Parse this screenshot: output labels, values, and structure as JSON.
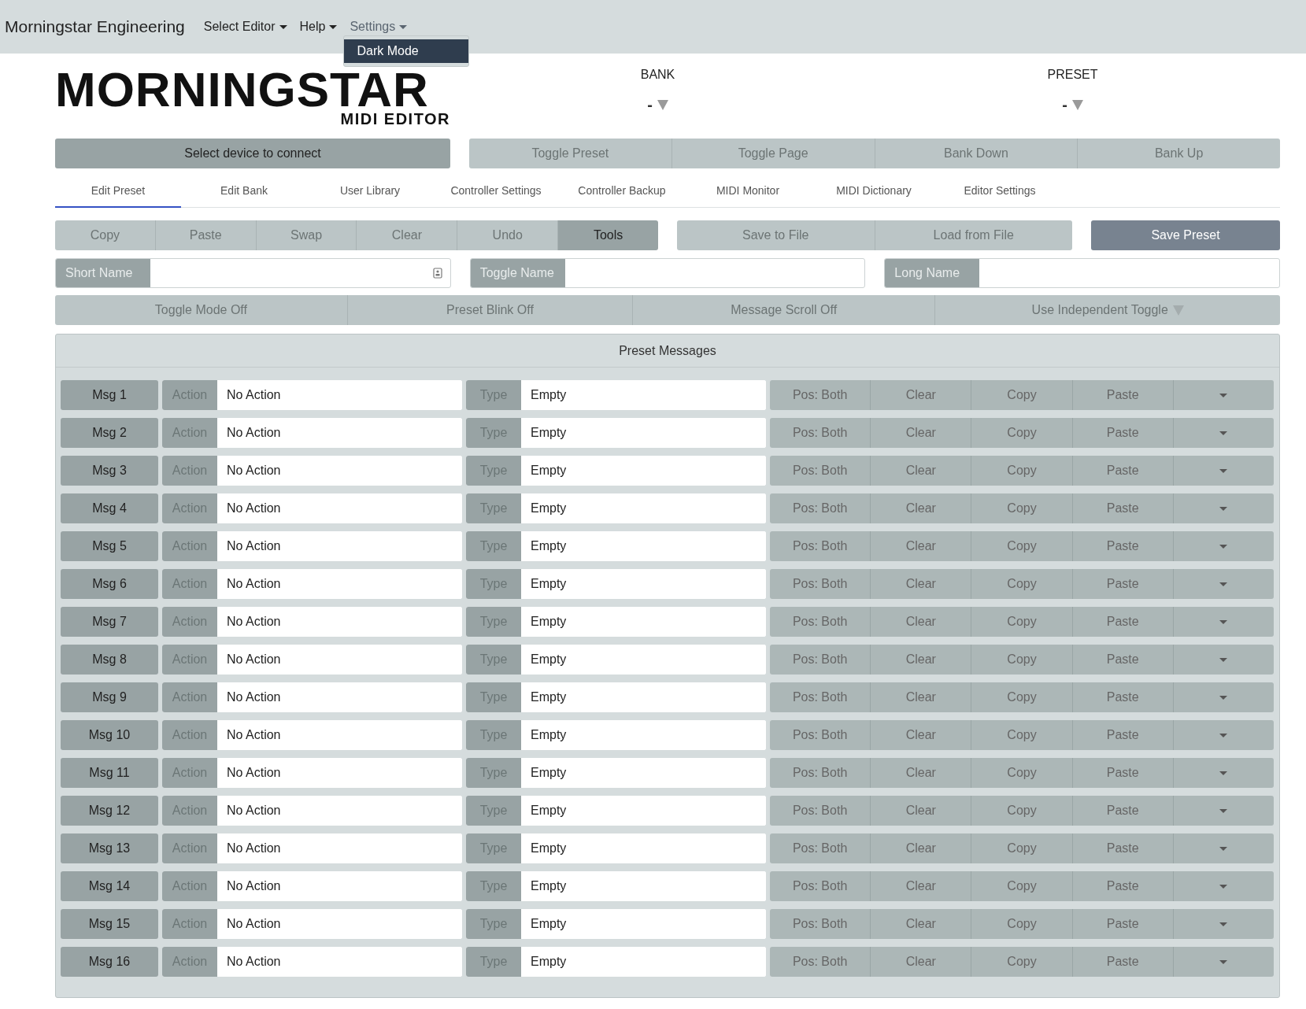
{
  "navbar": {
    "brand": "Morningstar Engineering",
    "menus": [
      {
        "label": "Select Editor",
        "open": false
      },
      {
        "label": "Help",
        "open": false
      },
      {
        "label": "Settings",
        "open": true
      }
    ],
    "dropdown": {
      "items": [
        {
          "label": "Dark Mode",
          "selected": true
        }
      ]
    }
  },
  "header": {
    "logo": {
      "title": "MORNINGSTAR",
      "subtitle": "MIDI EDITOR"
    },
    "selectors": [
      {
        "label": "BANK",
        "value": "-"
      },
      {
        "label": "PRESET",
        "value": "-"
      }
    ]
  },
  "connect_button": "Select device to connect",
  "transport_buttons": [
    "Toggle Preset",
    "Toggle Page",
    "Bank Down",
    "Bank Up"
  ],
  "tabs": [
    {
      "label": "Edit Preset",
      "selected": true
    },
    {
      "label": "Edit Bank",
      "selected": false
    },
    {
      "label": "User Library",
      "selected": false
    },
    {
      "label": "Controller Settings",
      "selected": false
    },
    {
      "label": "Controller Backup",
      "selected": false
    },
    {
      "label": "MIDI Monitor",
      "selected": false
    },
    {
      "label": "MIDI Dictionary",
      "selected": false
    },
    {
      "label": "Editor Settings",
      "selected": false
    }
  ],
  "edit_tools": [
    {
      "label": "Copy",
      "selected": false
    },
    {
      "label": "Paste",
      "selected": false
    },
    {
      "label": "Swap",
      "selected": false
    },
    {
      "label": "Clear",
      "selected": false
    },
    {
      "label": "Undo",
      "selected": false
    },
    {
      "label": "Tools",
      "selected": true
    }
  ],
  "file_buttons": [
    "Save to File",
    "Load from File"
  ],
  "save_button": "Save Preset",
  "name_fields": [
    {
      "label": "Short Name",
      "icon": true
    },
    {
      "label": "Toggle Name",
      "icon": false
    },
    {
      "label": "Long Name",
      "icon": false
    }
  ],
  "toggles": [
    {
      "label": "Toggle Mode Off",
      "kind": "button"
    },
    {
      "label": "Preset Blink Off",
      "kind": "button"
    },
    {
      "label": "Message Scroll Off",
      "kind": "button"
    },
    {
      "label": "Use Independent Toggle",
      "kind": "dropdown"
    }
  ],
  "preset_messages": {
    "title": "Preset Messages",
    "rows": [
      {
        "msg": "Msg 1",
        "action_label": "Action",
        "action": "No Action",
        "type_label": "Type",
        "type": "Empty",
        "pos": "Pos: Both",
        "clear": "Clear",
        "copy": "Copy",
        "paste": "Paste"
      },
      {
        "msg": "Msg 2",
        "action_label": "Action",
        "action": "No Action",
        "type_label": "Type",
        "type": "Empty",
        "pos": "Pos: Both",
        "clear": "Clear",
        "copy": "Copy",
        "paste": "Paste"
      },
      {
        "msg": "Msg 3",
        "action_label": "Action",
        "action": "No Action",
        "type_label": "Type",
        "type": "Empty",
        "pos": "Pos: Both",
        "clear": "Clear",
        "copy": "Copy",
        "paste": "Paste"
      },
      {
        "msg": "Msg 4",
        "action_label": "Action",
        "action": "No Action",
        "type_label": "Type",
        "type": "Empty",
        "pos": "Pos: Both",
        "clear": "Clear",
        "copy": "Copy",
        "paste": "Paste"
      },
      {
        "msg": "Msg 5",
        "action_label": "Action",
        "action": "No Action",
        "type_label": "Type",
        "type": "Empty",
        "pos": "Pos: Both",
        "clear": "Clear",
        "copy": "Copy",
        "paste": "Paste"
      },
      {
        "msg": "Msg 6",
        "action_label": "Action",
        "action": "No Action",
        "type_label": "Type",
        "type": "Empty",
        "pos": "Pos: Both",
        "clear": "Clear",
        "copy": "Copy",
        "paste": "Paste"
      },
      {
        "msg": "Msg 7",
        "action_label": "Action",
        "action": "No Action",
        "type_label": "Type",
        "type": "Empty",
        "pos": "Pos: Both",
        "clear": "Clear",
        "copy": "Copy",
        "paste": "Paste"
      },
      {
        "msg": "Msg 8",
        "action_label": "Action",
        "action": "No Action",
        "type_label": "Type",
        "type": "Empty",
        "pos": "Pos: Both",
        "clear": "Clear",
        "copy": "Copy",
        "paste": "Paste"
      },
      {
        "msg": "Msg 9",
        "action_label": "Action",
        "action": "No Action",
        "type_label": "Type",
        "type": "Empty",
        "pos": "Pos: Both",
        "clear": "Clear",
        "copy": "Copy",
        "paste": "Paste"
      },
      {
        "msg": "Msg 10",
        "action_label": "Action",
        "action": "No Action",
        "type_label": "Type",
        "type": "Empty",
        "pos": "Pos: Both",
        "clear": "Clear",
        "copy": "Copy",
        "paste": "Paste"
      },
      {
        "msg": "Msg 11",
        "action_label": "Action",
        "action": "No Action",
        "type_label": "Type",
        "type": "Empty",
        "pos": "Pos: Both",
        "clear": "Clear",
        "copy": "Copy",
        "paste": "Paste"
      },
      {
        "msg": "Msg 12",
        "action_label": "Action",
        "action": "No Action",
        "type_label": "Type",
        "type": "Empty",
        "pos": "Pos: Both",
        "clear": "Clear",
        "copy": "Copy",
        "paste": "Paste"
      },
      {
        "msg": "Msg 13",
        "action_label": "Action",
        "action": "No Action",
        "type_label": "Type",
        "type": "Empty",
        "pos": "Pos: Both",
        "clear": "Clear",
        "copy": "Copy",
        "paste": "Paste"
      },
      {
        "msg": "Msg 14",
        "action_label": "Action",
        "action": "No Action",
        "type_label": "Type",
        "type": "Empty",
        "pos": "Pos: Both",
        "clear": "Clear",
        "copy": "Copy",
        "paste": "Paste"
      },
      {
        "msg": "Msg 15",
        "action_label": "Action",
        "action": "No Action",
        "type_label": "Type",
        "type": "Empty",
        "pos": "Pos: Both",
        "clear": "Clear",
        "copy": "Copy",
        "paste": "Paste"
      },
      {
        "msg": "Msg 16",
        "action_label": "Action",
        "action": "No Action",
        "type_label": "Type",
        "type": "Empty",
        "pos": "Pos: Both",
        "clear": "Clear",
        "copy": "Copy",
        "paste": "Paste"
      }
    ]
  }
}
